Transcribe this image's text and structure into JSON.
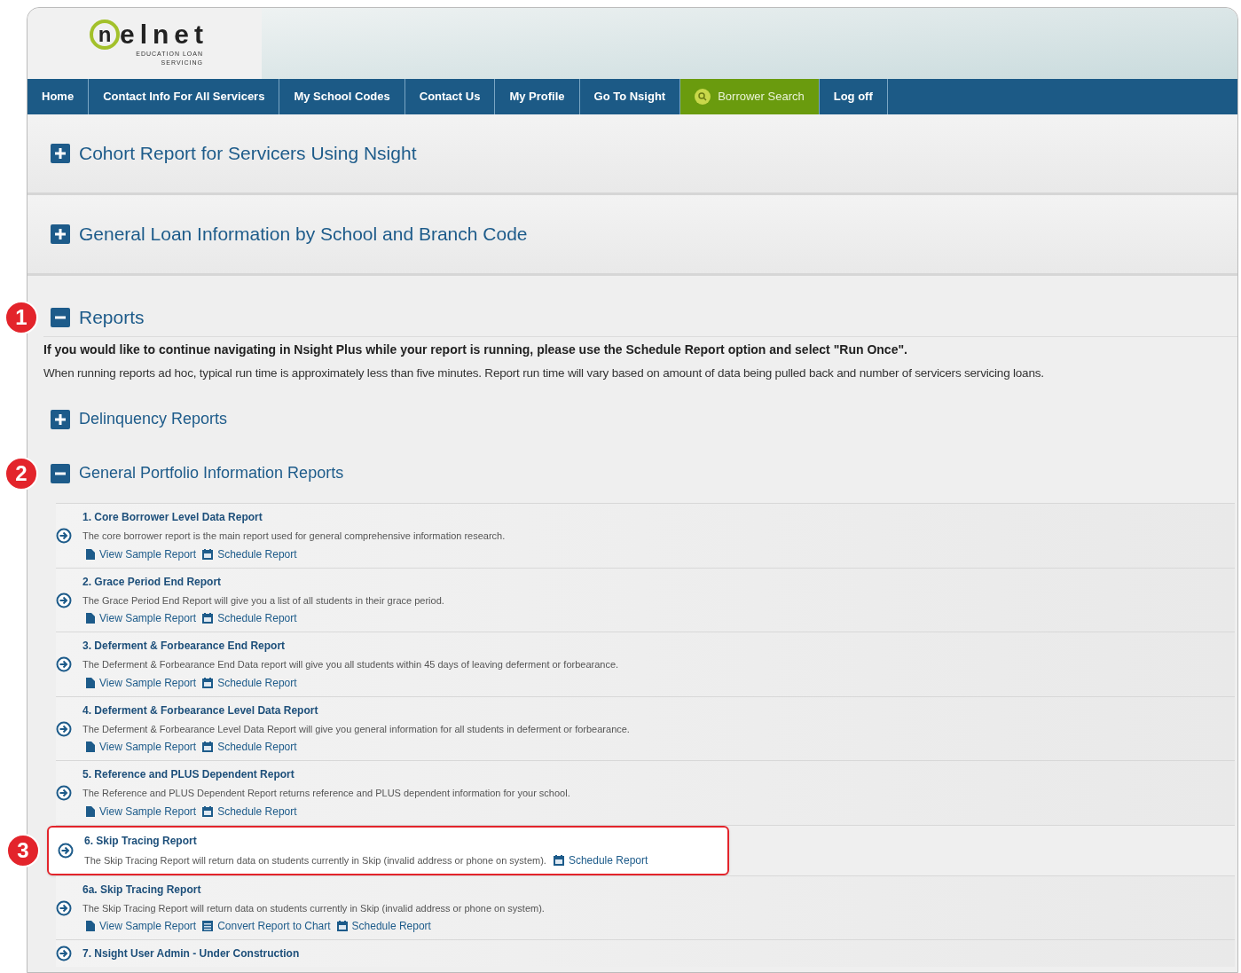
{
  "logo": {
    "mark": "n",
    "word": "elnet",
    "tagline": [
      "EDUCATION LOAN",
      "SERVICING"
    ]
  },
  "nav": [
    {
      "label": "Home",
      "kind": "plain"
    },
    {
      "label": "Contact Info For All Servicers",
      "kind": "plain"
    },
    {
      "label": "My School Codes",
      "kind": "plain"
    },
    {
      "label": "Contact Us",
      "kind": "plain"
    },
    {
      "label": "My Profile",
      "kind": "plain"
    },
    {
      "label": "Go To Nsight",
      "kind": "plain"
    },
    {
      "label": "Borrower Search",
      "kind": "featured"
    },
    {
      "label": "Log off",
      "kind": "plain"
    }
  ],
  "top_sections": [
    {
      "title": "Cohort Report for Servicers Using Nsight",
      "expanded": false
    },
    {
      "title": "General Loan Information by School and Branch Code",
      "expanded": false
    }
  ],
  "reports": {
    "title": "Reports",
    "expanded": true,
    "callout": "1",
    "notice": "If you would like to continue navigating in Nsight Plus while your report is running, please use the Schedule Report option and select \"Run Once\".",
    "note": "When running reports ad hoc, typical run time is approximately less than five minutes. Report run time will vary based on amount of data being pulled back and number of servicers servicing loans.",
    "groups": [
      {
        "title": "Delinquency Reports",
        "expanded": false
      },
      {
        "title": "General Portfolio Information Reports",
        "expanded": true,
        "callout": "2",
        "items": [
          {
            "title": "1. Core Borrower Level Data Report",
            "description": "The core borrower report is the main report used for general comprehensive information research.",
            "highlighted": false,
            "links": [
              {
                "kind": "view",
                "label": "View Sample Report"
              },
              {
                "kind": "schedule",
                "label": "Schedule Report"
              }
            ]
          },
          {
            "title": "2. Grace Period End Report",
            "description": "The Grace Period End Report will give you a list of all students in their grace period.",
            "highlighted": false,
            "links": [
              {
                "kind": "view",
                "label": "View Sample Report"
              },
              {
                "kind": "schedule",
                "label": "Schedule Report"
              }
            ]
          },
          {
            "title": "3. Deferment & Forbearance End Report",
            "description": "The Deferment & Forbearance End Data report will give you all students within 45 days of leaving deferment or forbearance.",
            "highlighted": false,
            "links": [
              {
                "kind": "view",
                "label": "View Sample Report"
              },
              {
                "kind": "schedule",
                "label": "Schedule Report"
              }
            ]
          },
          {
            "title": "4. Deferment & Forbearance Level Data Report",
            "description": "The Deferment & Forbearance Level Data Report will give you general information for all students in deferment or forbearance.",
            "highlighted": false,
            "links": [
              {
                "kind": "view",
                "label": "View Sample Report"
              },
              {
                "kind": "schedule",
                "label": "Schedule Report"
              }
            ]
          },
          {
            "title": "5. Reference and PLUS Dependent Report",
            "description": "The Reference and PLUS Dependent Report returns reference and PLUS dependent information for your school.",
            "highlighted": false,
            "links": [
              {
                "kind": "view",
                "label": "View Sample Report"
              },
              {
                "kind": "schedule",
                "label": "Schedule Report"
              }
            ]
          },
          {
            "title": "6. Skip Tracing Report",
            "description": "The Skip Tracing Report will return data on students currently in Skip (invalid address or phone on system).",
            "highlighted": true,
            "callout": "3",
            "links": [
              {
                "kind": "schedule",
                "label": "Schedule Report"
              }
            ]
          },
          {
            "title": "6a. Skip Tracing Report",
            "description": "The Skip Tracing Report will return data on students currently in Skip (invalid address or phone on system).",
            "highlighted": false,
            "links": [
              {
                "kind": "view",
                "label": "View Sample Report"
              },
              {
                "kind": "chart",
                "label": "Convert Report to Chart"
              },
              {
                "kind": "schedule",
                "label": "Schedule Report"
              }
            ]
          },
          {
            "title": "7. Nsight User Admin - Under Construction",
            "highlighted": false
          }
        ]
      }
    ]
  }
}
